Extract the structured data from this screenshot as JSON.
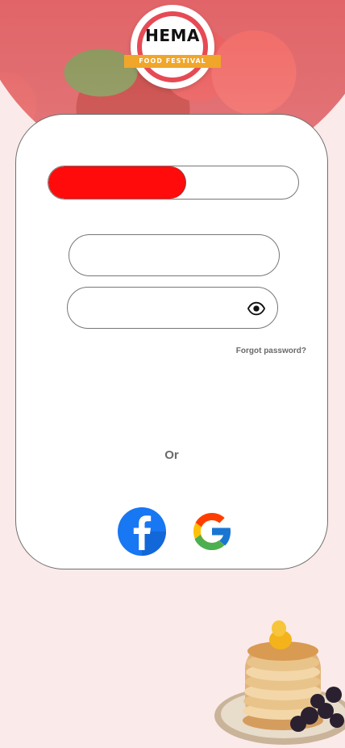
{
  "logo": {
    "title": "HEMA",
    "subtitle": "FOOD FESTIVAL"
  },
  "progress": {
    "value": 0.55,
    "fill_color": "#ff0b0b"
  },
  "form": {
    "username": {
      "value": "",
      "placeholder": ""
    },
    "password": {
      "value": "",
      "placeholder": ""
    },
    "forgot_label": "Forgot password?",
    "or_label": "Or"
  },
  "social": {
    "facebook_icon": "facebook-icon",
    "google_icon": "google-icon"
  },
  "colors": {
    "background": "#fbeaea",
    "accent_red": "#ff0b0b",
    "facebook_blue": "#1877f2"
  }
}
